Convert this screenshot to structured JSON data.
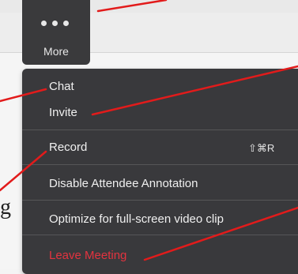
{
  "toolbar": {
    "more_label": "More",
    "more_icon": "ellipsis-icon"
  },
  "menu": {
    "items": [
      {
        "label": "Chat"
      },
      {
        "label": "Invite"
      },
      {
        "label": "Record",
        "shortcut": "⇧⌘R"
      },
      {
        "label": "Disable Attendee Annotation"
      },
      {
        "label": "Optimize for full-screen video clip"
      },
      {
        "label": "Leave Meeting"
      }
    ]
  },
  "background": {
    "partial_letter": "g"
  },
  "colors": {
    "menu_bg": "#39393c",
    "toolbar_bg": "#3a3a3c",
    "menu_text": "#f0f0f0",
    "danger": "#e3333f",
    "annotation_line": "#e21b1b"
  }
}
